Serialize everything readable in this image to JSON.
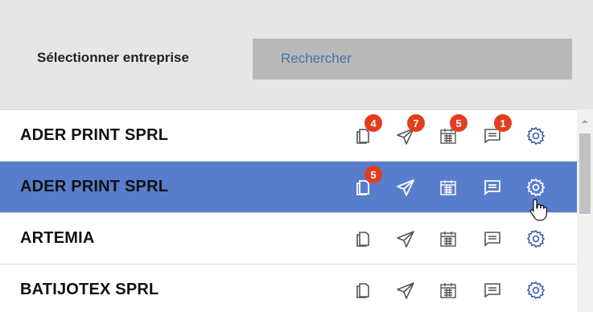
{
  "header": {
    "label": "Sélectionner entreprise",
    "search_placeholder": "Rechercher"
  },
  "rows": [
    {
      "name": "ADER PRINT SPRL",
      "selected": false,
      "badges": {
        "documents": "4",
        "send": "7",
        "calendar": "5",
        "messages": "1"
      }
    },
    {
      "name": "ADER PRINT SPRL",
      "selected": true,
      "badges": {
        "documents": "5"
      }
    },
    {
      "name": "ARTEMIA",
      "selected": false,
      "badges": {}
    },
    {
      "name": "BATIJOTEX SPRL",
      "selected": false,
      "badges": {}
    }
  ],
  "icons": [
    "documents-icon",
    "send-icon",
    "calendar-icon",
    "messages-icon",
    "settings-icon"
  ],
  "colors": {
    "header_bg": "#e6e6e6",
    "search_bg": "#b9b9b9",
    "search_text": "#4a6fa8",
    "selected_row": "#587dcd",
    "badge": "#e23e1e",
    "icon_default": "#555555",
    "icon_selected": "#ffffff",
    "settings_icon": "#3b5da8"
  }
}
